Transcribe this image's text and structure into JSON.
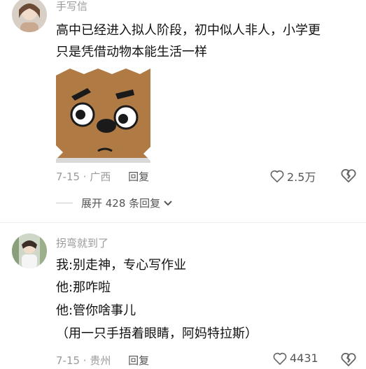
{
  "comments": [
    {
      "username": "手写信",
      "lines": [
        "高中已经进入拟人阶段，初中似人非人，小学更",
        "只是凭借动物本能生活一样"
      ],
      "date_location": "7-15 · 广西",
      "reply_label": "回复",
      "likes": "2.5万",
      "expand_label": "展开 428 条回复",
      "sticker": "cartoon-dog-face"
    },
    {
      "username": "拐弯就到了",
      "lines": [
        "我:别走神，专心写作业",
        "他:那咋啦",
        "他:管你啥事儿",
        "（用一只手捂着眼睛，阿妈特拉斯）"
      ],
      "date_location": "7-15 · 贵州",
      "reply_label": "回复",
      "likes": "4431"
    }
  ],
  "colors": {
    "meta": "#9a9a9a",
    "text": "#111111",
    "sticker_fur": "#b07a45"
  }
}
